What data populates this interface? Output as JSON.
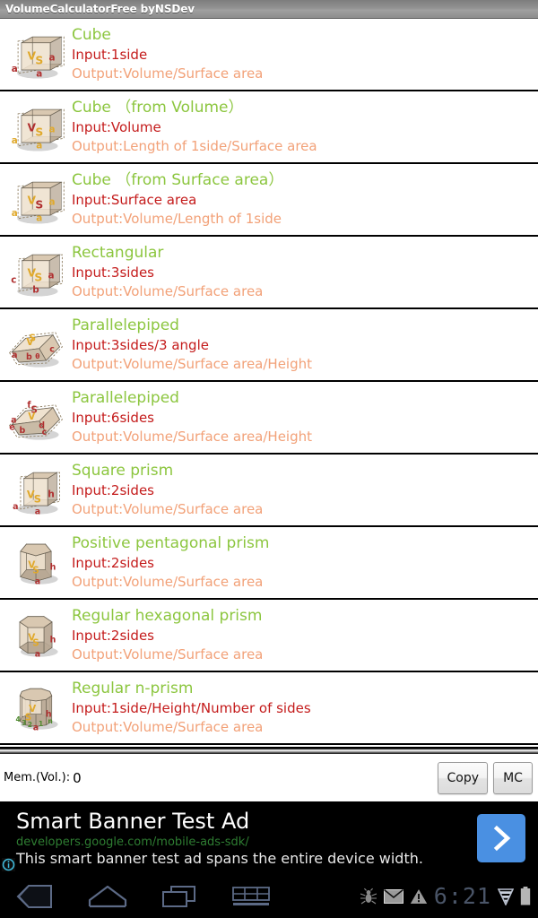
{
  "titlebar": {
    "app_title": "VolumeCalculatorFree byNSDev"
  },
  "list": {
    "items": [
      {
        "icon": "cube-icon",
        "title": "Cube",
        "input": "Input:1side",
        "output": "Output:Volume/Surface area"
      },
      {
        "icon": "cube-from-volume-icon",
        "title": "Cube （from Volume）",
        "input": "Input:Volume",
        "output": "Output:Length of 1side/Surface area"
      },
      {
        "icon": "cube-from-surface-icon",
        "title": "Cube （from Surface area）",
        "input": "Input:Surface area",
        "output": "Output:Volume/Length of 1side"
      },
      {
        "icon": "rectangular-icon",
        "title": "Rectangular",
        "input": "Input:3sides",
        "output": "Output:Volume/Surface area"
      },
      {
        "icon": "parallelepiped-angle-icon",
        "title": "Parallelepiped",
        "input": "Input:3sides/3 angle",
        "output": "Output:Volume/Surface area/Height"
      },
      {
        "icon": "parallelepiped-6side-icon",
        "title": "Parallelepiped",
        "input": "Input:6sides",
        "output": "Output:Volume/Surface area/Height"
      },
      {
        "icon": "square-prism-icon",
        "title": "Square prism",
        "input": "Input:2sides",
        "output": "Output:Volume/Surface area"
      },
      {
        "icon": "pentagonal-prism-icon",
        "title": "Positive pentagonal prism",
        "input": "Input:2sides",
        "output": "Output:Volume/Surface area"
      },
      {
        "icon": "hexagonal-prism-icon",
        "title": "Regular hexagonal prism",
        "input": "Input:2sides",
        "output": "Output:Volume/Surface area"
      },
      {
        "icon": "n-prism-icon",
        "title": "Regular n-prism",
        "input": "Input:1side/Height/Number of sides",
        "output": "Output:Volume/Surface area"
      }
    ]
  },
  "memory": {
    "label": "Mem.(Vol.):",
    "value": "0",
    "copy_label": "Copy",
    "mc_label": "MC"
  },
  "ad": {
    "headline": "Smart Banner Test Ad",
    "url": "developers.google.com/mobile-ads-sdk/",
    "body": "This smart banner test ad spans the entire device width.",
    "cta_glyph": "›"
  },
  "navbar": {
    "back_label": "back-button",
    "home_label": "home-button",
    "recents_label": "recent-apps-button",
    "keyboard_label": "keyboard-button",
    "clock": "6:21"
  },
  "colors": {
    "title_green": "#8cc63f",
    "input_red": "#c41b1b",
    "output_orange": "#f2a178",
    "ad_cta_blue": "#4a90e2",
    "ad_url_green": "#2e7d32"
  }
}
